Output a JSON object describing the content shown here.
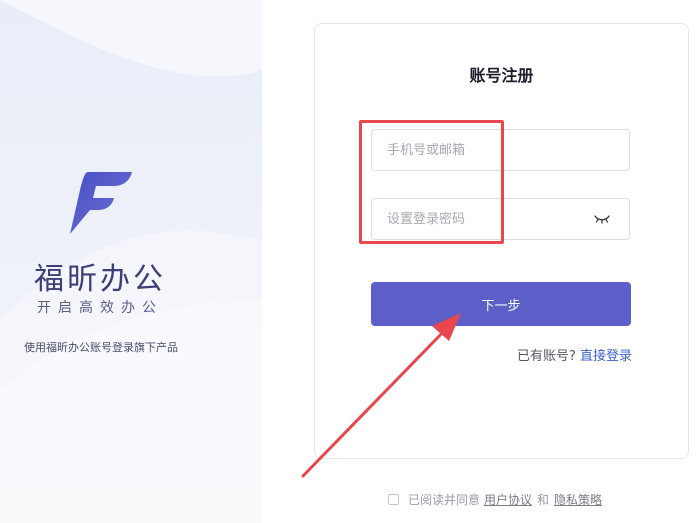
{
  "brand": {
    "name": "福昕办公",
    "slogan": "开启高效办公",
    "description": "使用福昕办公账号登录旗下产品",
    "accent_color": "#5b5fc7"
  },
  "form": {
    "title": "账号注册",
    "phone_placeholder": "手机号或邮箱",
    "password_placeholder": "设置登录密码",
    "password_toggle_icon": "eye-closed-icon",
    "next_label": "下一步",
    "has_account_text": "已有账号?",
    "login_link": "直接登录"
  },
  "agreement": {
    "prefix": "已阅读并同意",
    "user_agreement": "用户协议",
    "conjunction": "和",
    "privacy_policy": "隐私策略"
  },
  "annotation": {
    "highlight_color": "#e8474e"
  }
}
